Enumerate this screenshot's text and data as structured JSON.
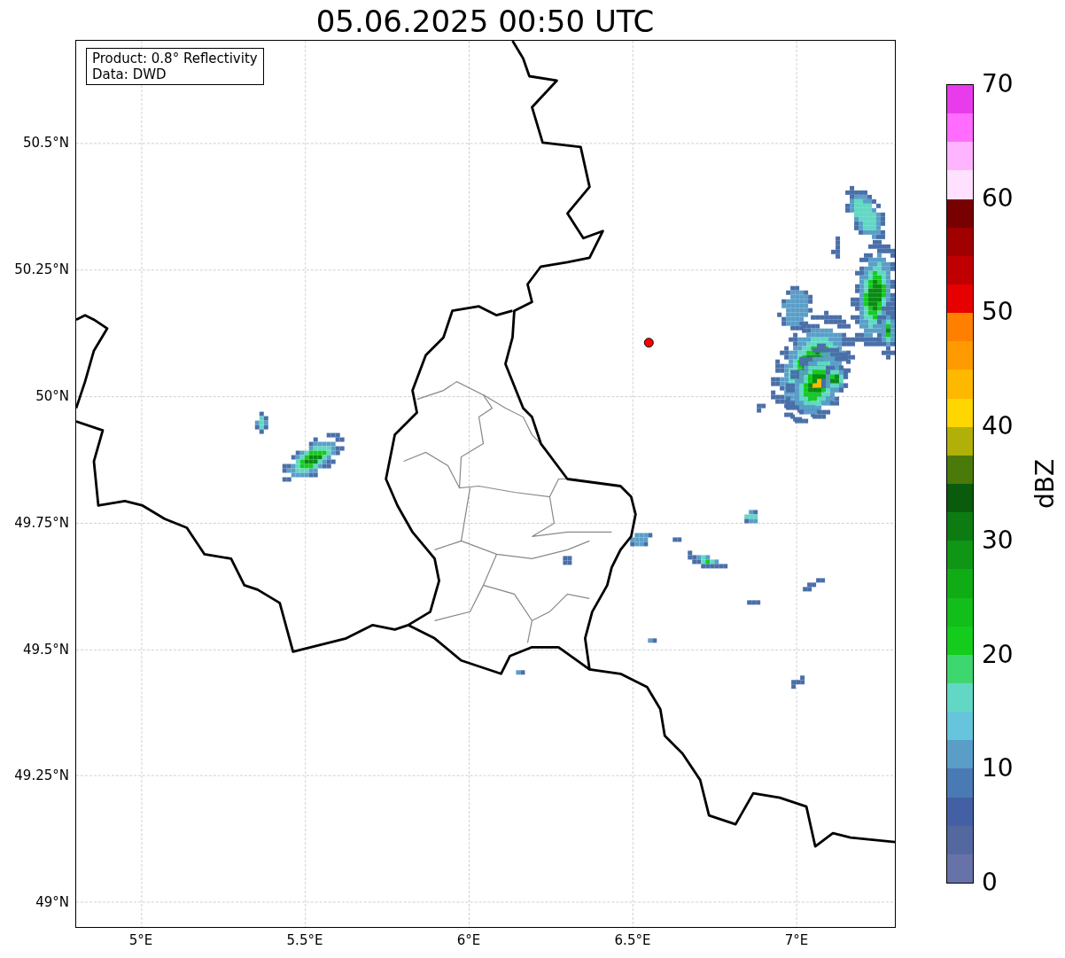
{
  "title": "05.06.2025 00:50 UTC",
  "info_box": {
    "lines": [
      "Product: 0.8° Reflectivity",
      "Data: DWD"
    ]
  },
  "map": {
    "lat_ticks": [
      "50.5°N",
      "50.25°N",
      "50°N",
      "49.75°N",
      "49.5°N",
      "49.25°N",
      "49°N"
    ],
    "lon_ticks": [
      "5°E",
      "5.5°E",
      "6°E",
      "6.5°E",
      "7°E"
    ]
  },
  "colorbar": {
    "label": "dBZ",
    "ticks": [
      "70",
      "60",
      "50",
      "40",
      "30",
      "20",
      "10",
      "0"
    ],
    "bands": [
      {
        "color": "#6672a8"
      },
      {
        "color": "#5468a0"
      },
      {
        "color": "#4460a4"
      },
      {
        "color": "#4a7ab4"
      },
      {
        "color": "#5a9ec8"
      },
      {
        "color": "#66c4dc"
      },
      {
        "color": "#62d8c4"
      },
      {
        "color": "#3ed66e"
      },
      {
        "color": "#14cc1c"
      },
      {
        "color": "#12be1a"
      },
      {
        "color": "#10ac16"
      },
      {
        "color": "#0e9614"
      },
      {
        "color": "#0c7c12"
      },
      {
        "color": "#0a5c0c"
      },
      {
        "color": "#4a7a0a"
      },
      {
        "color": "#b0b008"
      },
      {
        "color": "#ffd600"
      },
      {
        "color": "#ffb800"
      },
      {
        "color": "#ff9a00"
      },
      {
        "color": "#ff8000"
      },
      {
        "color": "#e60000"
      },
      {
        "color": "#c00000"
      },
      {
        "color": "#a00000"
      },
      {
        "color": "#780000"
      },
      {
        "color": "#ffe0ff"
      },
      {
        "color": "#ffb4ff"
      },
      {
        "color": "#ff6cff"
      },
      {
        "color": "#e83cec"
      }
    ]
  }
}
